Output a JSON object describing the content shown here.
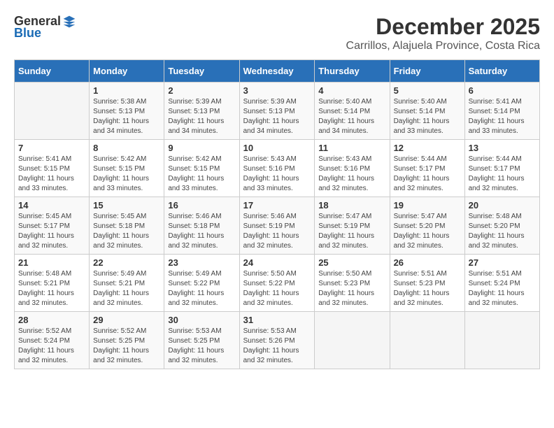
{
  "header": {
    "logo_general": "General",
    "logo_blue": "Blue",
    "month_year": "December 2025",
    "location": "Carrillos, Alajuela Province, Costa Rica"
  },
  "calendar": {
    "headers": [
      "Sunday",
      "Monday",
      "Tuesday",
      "Wednesday",
      "Thursday",
      "Friday",
      "Saturday"
    ],
    "weeks": [
      [
        {
          "day": "",
          "info": ""
        },
        {
          "day": "1",
          "info": "Sunrise: 5:38 AM\nSunset: 5:13 PM\nDaylight: 11 hours\nand 34 minutes."
        },
        {
          "day": "2",
          "info": "Sunrise: 5:39 AM\nSunset: 5:13 PM\nDaylight: 11 hours\nand 34 minutes."
        },
        {
          "day": "3",
          "info": "Sunrise: 5:39 AM\nSunset: 5:13 PM\nDaylight: 11 hours\nand 34 minutes."
        },
        {
          "day": "4",
          "info": "Sunrise: 5:40 AM\nSunset: 5:14 PM\nDaylight: 11 hours\nand 34 minutes."
        },
        {
          "day": "5",
          "info": "Sunrise: 5:40 AM\nSunset: 5:14 PM\nDaylight: 11 hours\nand 33 minutes."
        },
        {
          "day": "6",
          "info": "Sunrise: 5:41 AM\nSunset: 5:14 PM\nDaylight: 11 hours\nand 33 minutes."
        }
      ],
      [
        {
          "day": "7",
          "info": "Sunrise: 5:41 AM\nSunset: 5:15 PM\nDaylight: 11 hours\nand 33 minutes."
        },
        {
          "day": "8",
          "info": "Sunrise: 5:42 AM\nSunset: 5:15 PM\nDaylight: 11 hours\nand 33 minutes."
        },
        {
          "day": "9",
          "info": "Sunrise: 5:42 AM\nSunset: 5:15 PM\nDaylight: 11 hours\nand 33 minutes."
        },
        {
          "day": "10",
          "info": "Sunrise: 5:43 AM\nSunset: 5:16 PM\nDaylight: 11 hours\nand 33 minutes."
        },
        {
          "day": "11",
          "info": "Sunrise: 5:43 AM\nSunset: 5:16 PM\nDaylight: 11 hours\nand 32 minutes."
        },
        {
          "day": "12",
          "info": "Sunrise: 5:44 AM\nSunset: 5:17 PM\nDaylight: 11 hours\nand 32 minutes."
        },
        {
          "day": "13",
          "info": "Sunrise: 5:44 AM\nSunset: 5:17 PM\nDaylight: 11 hours\nand 32 minutes."
        }
      ],
      [
        {
          "day": "14",
          "info": "Sunrise: 5:45 AM\nSunset: 5:17 PM\nDaylight: 11 hours\nand 32 minutes."
        },
        {
          "day": "15",
          "info": "Sunrise: 5:45 AM\nSunset: 5:18 PM\nDaylight: 11 hours\nand 32 minutes."
        },
        {
          "day": "16",
          "info": "Sunrise: 5:46 AM\nSunset: 5:18 PM\nDaylight: 11 hours\nand 32 minutes."
        },
        {
          "day": "17",
          "info": "Sunrise: 5:46 AM\nSunset: 5:19 PM\nDaylight: 11 hours\nand 32 minutes."
        },
        {
          "day": "18",
          "info": "Sunrise: 5:47 AM\nSunset: 5:19 PM\nDaylight: 11 hours\nand 32 minutes."
        },
        {
          "day": "19",
          "info": "Sunrise: 5:47 AM\nSunset: 5:20 PM\nDaylight: 11 hours\nand 32 minutes."
        },
        {
          "day": "20",
          "info": "Sunrise: 5:48 AM\nSunset: 5:20 PM\nDaylight: 11 hours\nand 32 minutes."
        }
      ],
      [
        {
          "day": "21",
          "info": "Sunrise: 5:48 AM\nSunset: 5:21 PM\nDaylight: 11 hours\nand 32 minutes."
        },
        {
          "day": "22",
          "info": "Sunrise: 5:49 AM\nSunset: 5:21 PM\nDaylight: 11 hours\nand 32 minutes."
        },
        {
          "day": "23",
          "info": "Sunrise: 5:49 AM\nSunset: 5:22 PM\nDaylight: 11 hours\nand 32 minutes."
        },
        {
          "day": "24",
          "info": "Sunrise: 5:50 AM\nSunset: 5:22 PM\nDaylight: 11 hours\nand 32 minutes."
        },
        {
          "day": "25",
          "info": "Sunrise: 5:50 AM\nSunset: 5:23 PM\nDaylight: 11 hours\nand 32 minutes."
        },
        {
          "day": "26",
          "info": "Sunrise: 5:51 AM\nSunset: 5:23 PM\nDaylight: 11 hours\nand 32 minutes."
        },
        {
          "day": "27",
          "info": "Sunrise: 5:51 AM\nSunset: 5:24 PM\nDaylight: 11 hours\nand 32 minutes."
        }
      ],
      [
        {
          "day": "28",
          "info": "Sunrise: 5:52 AM\nSunset: 5:24 PM\nDaylight: 11 hours\nand 32 minutes."
        },
        {
          "day": "29",
          "info": "Sunrise: 5:52 AM\nSunset: 5:25 PM\nDaylight: 11 hours\nand 32 minutes."
        },
        {
          "day": "30",
          "info": "Sunrise: 5:53 AM\nSunset: 5:25 PM\nDaylight: 11 hours\nand 32 minutes."
        },
        {
          "day": "31",
          "info": "Sunrise: 5:53 AM\nSunset: 5:26 PM\nDaylight: 11 hours\nand 32 minutes."
        },
        {
          "day": "",
          "info": ""
        },
        {
          "day": "",
          "info": ""
        },
        {
          "day": "",
          "info": ""
        }
      ]
    ]
  }
}
